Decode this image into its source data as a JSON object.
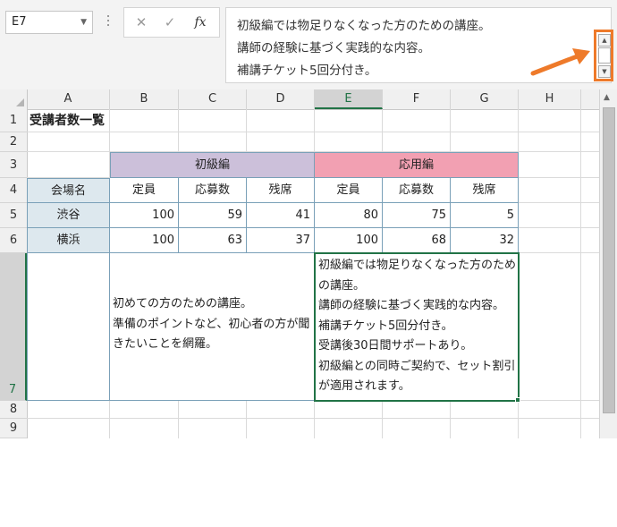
{
  "name_box": {
    "value": "E7"
  },
  "formula_bar": {
    "cancel_glyph": "✕",
    "enter_glyph": "✓",
    "fx_label": "fx",
    "lines": [
      "初級編では物足りなくなった方のための講座。",
      "講師の経験に基づく実践的な内容。",
      "補講チケット5回分付き。"
    ]
  },
  "columns": [
    "A",
    "B",
    "C",
    "D",
    "E",
    "F",
    "G",
    "H"
  ],
  "selected_column": "E",
  "rows": [
    "1",
    "2",
    "3",
    "4",
    "5",
    "6",
    "7",
    "8",
    "9"
  ],
  "selected_row": "7",
  "sheet": {
    "title": "受講者数一覧",
    "group_beginner": "初級編",
    "group_advanced": "応用編",
    "venue_header": "会場名",
    "sub_headers": [
      "定員",
      "応募数",
      "残席",
      "定員",
      "応募数",
      "残席"
    ],
    "data_rows": [
      {
        "venue": "渋谷",
        "values": [
          "100",
          "59",
          "41",
          "80",
          "75",
          "5"
        ]
      },
      {
        "venue": "横浜",
        "values": [
          "100",
          "63",
          "37",
          "100",
          "68",
          "32"
        ]
      }
    ],
    "beginner_desc": [
      "初めての方のための講座。",
      "準備のポイントなど、初心者の方が聞",
      "きたいことを網羅。"
    ],
    "advanced_desc": [
      "初級編では物足りなくなった方のため",
      "の講座。",
      "講師の経験に基づく実践的な内容。",
      "補講チケット5回分付き。",
      "受講後30日間サポートあり。",
      "初級編との同時ご契約で、セット割引",
      "が適用されます。"
    ]
  },
  "colors": {
    "beginner_fill": "#ccc0da",
    "advanced_fill": "#f2a0b2",
    "header_fill": "#dde8ee",
    "selection": "#217346",
    "callout": "#ee7a2a"
  }
}
